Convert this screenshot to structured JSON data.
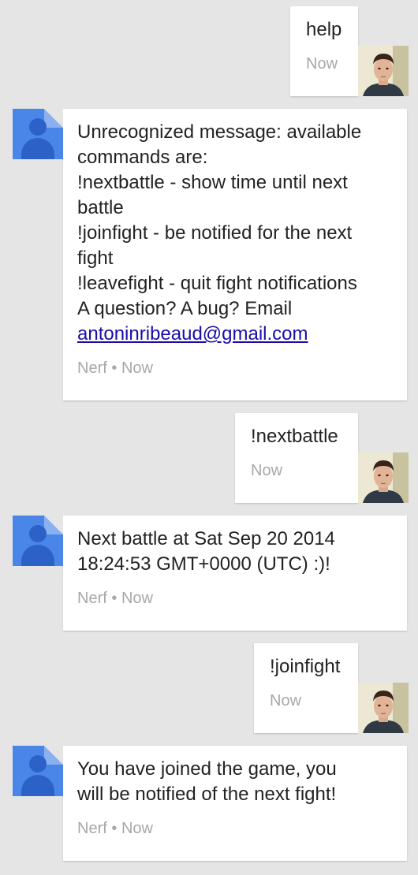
{
  "messages": [
    {
      "type": "outgoing",
      "text": "help",
      "time": "Now"
    },
    {
      "type": "incoming",
      "lines": [
        "Unrecognized message: available",
        "commands are:",
        "!nextbattle - show time until next",
        "battle",
        "!joinfight - be notified for the next",
        "fight",
        "!leavefight - quit fight notifications",
        "A question? A bug? Email"
      ],
      "link": "antoninribeaud@gmail.com",
      "sender": "Nerf",
      "separator": "•",
      "time": "Now"
    },
    {
      "type": "outgoing",
      "text": "!nextbattle",
      "time": "Now"
    },
    {
      "type": "incoming",
      "lines": [
        "Next battle at Sat Sep 20 2014",
        "18:24:53 GMT+0000 (UTC) :)!"
      ],
      "sender": "Nerf",
      "separator": "•",
      "time": "Now"
    },
    {
      "type": "outgoing",
      "text": "!joinfight",
      "time": "Now"
    },
    {
      "type": "incoming",
      "lines": [
        "You have joined the game, you",
        "will be notified of the next fight!"
      ],
      "sender": "Nerf",
      "separator": "•",
      "time": "Now"
    }
  ],
  "colors": {
    "background": "#e5e5e5",
    "avatar": "#4a86e8",
    "link": "#1a0dab"
  },
  "icons": {
    "bot_avatar": "person-icon",
    "user_avatar": "user-photo"
  }
}
